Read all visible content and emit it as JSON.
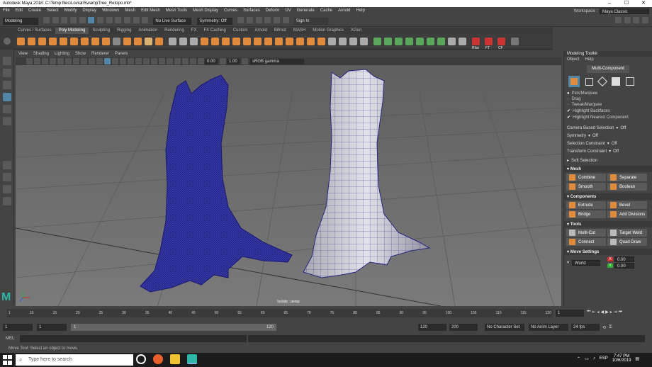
{
  "window": {
    "title": "Autodesk Maya 2018: C:\\Temp files\\Lovrat\\SwampTree_Retopo.mb*",
    "controls": [
      "–",
      "☐",
      "✕"
    ]
  },
  "menubar": {
    "items": [
      "File",
      "Edit",
      "Create",
      "Select",
      "Modify",
      "Display",
      "Windows",
      "Mesh",
      "Edit Mesh",
      "Mesh Tools",
      "Mesh Display",
      "Curves",
      "Surfaces",
      "Deform",
      "UV",
      "Generate",
      "Cache",
      "Arnold",
      "Help"
    ],
    "workspace_label": "Workspace :",
    "workspace_value": "Maya Classic"
  },
  "statusline": {
    "mode": "Modeling",
    "live_surface": "No Live Surface",
    "symmetry": "Symmetry: Off",
    "sign_in": "Sign In"
  },
  "shelf": {
    "tabs": [
      "Curves / Surfaces",
      "Poly Modeling",
      "Sculpting",
      "Rigging",
      "Animation",
      "Rendering",
      "FX",
      "FX Caching",
      "Custom",
      "Arnold",
      "Bifrost",
      "MASH",
      "Motion Graphics",
      "XGen"
    ],
    "active_tab": "Poly Modeling",
    "render_labels": [
      "Rlist",
      "FT",
      "CF"
    ]
  },
  "viewport": {
    "menus": [
      "View",
      "Shading",
      "Lighting",
      "Show",
      "Renderer",
      "Panels"
    ],
    "exposure": "0.00",
    "gamma": "1.00",
    "color_space": "sRGB gamma",
    "camera_label": "Isolate : persp"
  },
  "toolkit": {
    "title": "Modeling Toolkit",
    "menus": [
      "Object",
      "Help"
    ],
    "mode_button": "Multi-Component",
    "options": [
      {
        "label": "Pick/Marquee",
        "checked": true
      },
      {
        "label": "Drag",
        "checked": false
      },
      {
        "label": "Tweak/Marquee",
        "checked": false
      },
      {
        "label": "Highlight Backfaces",
        "checked": true
      },
      {
        "label": "Highlight Nearest Component",
        "checked": true
      }
    ],
    "camera_based_selection": {
      "label": "Camera Based Selection",
      "value": "Off"
    },
    "symmetry": {
      "label": "Symmetry",
      "value": "Off"
    },
    "selection_constraint": {
      "label": "Selection Constraint",
      "value": "Off"
    },
    "transform_constraint": {
      "label": "Transform Constraint",
      "value": "Off"
    },
    "soft_selection": "Soft Selection",
    "sections": [
      {
        "title": "Mesh",
        "buttons": [
          "Combine",
          "Separate",
          "Smooth",
          "Boolean"
        ]
      },
      {
        "title": "Components",
        "buttons": [
          "Extrude",
          "Bevel",
          "Bridge",
          "Add Divisions"
        ]
      },
      {
        "title": "Tools",
        "buttons": [
          "Multi-Cut",
          "Target Weld",
          "Connect",
          "Quad Draw"
        ]
      }
    ],
    "move_settings": "Move Settings",
    "world_label": "World",
    "axes": [
      {
        "axis": "X",
        "value": "0.00",
        "color": "#d03030"
      },
      {
        "axis": "Y",
        "value": "0.00",
        "color": "#30b030"
      }
    ]
  },
  "timeline": {
    "ticks": [
      "1",
      "10",
      "15",
      "20",
      "25",
      "30",
      "35",
      "40",
      "45",
      "50",
      "55",
      "60",
      "65",
      "70",
      "75",
      "80",
      "85",
      "90",
      "95",
      "100",
      "105",
      "110",
      "115",
      "120"
    ],
    "current_frame": "1",
    "range_start": "1",
    "range_start2": "1",
    "slider_start": "1",
    "slider_end": "120",
    "end": "120",
    "anim_end": "200",
    "character_set": "No Character Set",
    "anim_layer": "No Anim Layer",
    "fps": "24 fps"
  },
  "cmdline": {
    "label": "MEL"
  },
  "helpline": {
    "text": "Move Tool: Select an object to move."
  },
  "taskbar": {
    "search_placeholder": "Type here to search",
    "lang": "ESP",
    "time": "7:47 PM",
    "date": "10/6/2019"
  },
  "colors": {
    "accent": "#e08a3c",
    "selection_blue": "#5285a6",
    "wire_blue": "#2a2a9a"
  }
}
